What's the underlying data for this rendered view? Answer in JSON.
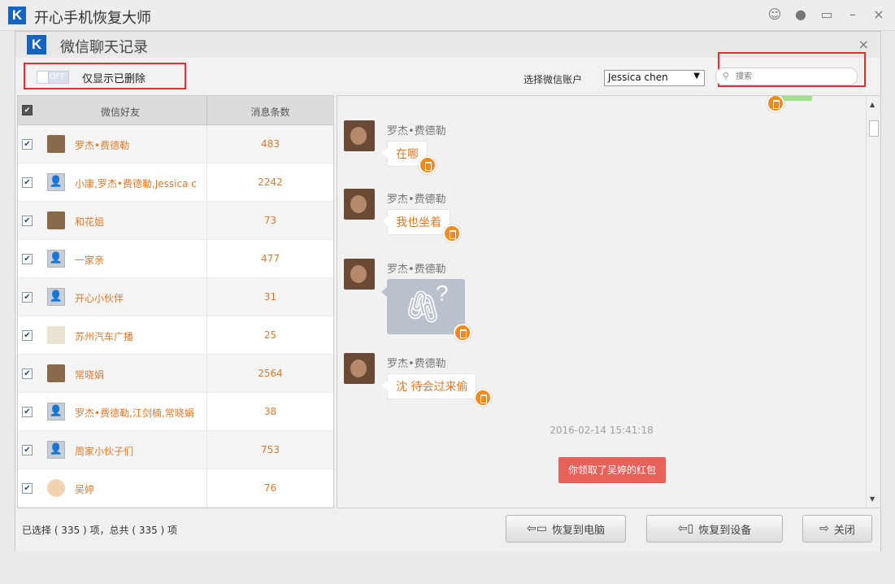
{
  "app": {
    "title": "开心手机恢复大师",
    "logo_letter": "K",
    "brand_color": "#1565c0"
  },
  "window_controls": [
    "wechat-icon",
    "chat-icon",
    "feedback-icon",
    "minimize",
    "close"
  ],
  "window_controls_glyphs": {
    "wechat": "☺",
    "chat": "●",
    "feedback": "▭",
    "minimize": "–",
    "close": "×"
  },
  "dialog": {
    "title": "微信聊天记录",
    "close_glyph": "×",
    "toolbar": {
      "toggle_state": "OFF",
      "filter_label": "仅显示已删除",
      "account_label": "选择微信账户",
      "account_selected": "Jessica chen",
      "search_placeholder": "搜索"
    },
    "list": {
      "columns": {
        "name": "微信好友",
        "count": "消息条数"
      },
      "rows": [
        {
          "name": "罗杰•费德勒",
          "count": "483",
          "avatar": "photo",
          "checked": true
        },
        {
          "name": "小康,罗杰•费德勒,Jessica c",
          "count": "2242",
          "avatar": "group",
          "checked": true
        },
        {
          "name": "和花姐",
          "count": "73",
          "avatar": "photo",
          "checked": true
        },
        {
          "name": "一家亲",
          "count": "477",
          "avatar": "group",
          "checked": true
        },
        {
          "name": "开心小伙伴",
          "count": "31",
          "avatar": "group",
          "checked": true
        },
        {
          "name": "苏州汽车广播",
          "count": "25",
          "avatar": "brand",
          "checked": true
        },
        {
          "name": "常晓娟",
          "count": "2564",
          "avatar": "photo",
          "checked": true
        },
        {
          "name": "罗杰•费德勒,江剑楠,常晓娟",
          "count": "38",
          "avatar": "group",
          "checked": true
        },
        {
          "name": "周家小伙子们",
          "count": "753",
          "avatar": "group",
          "checked": true
        },
        {
          "name": "吴婷",
          "count": "76",
          "avatar": "cartoon",
          "checked": true
        }
      ]
    },
    "chat": {
      "messages": [
        {
          "sender": "罗杰•费德勒",
          "text": "在哪",
          "kind": "text",
          "deleted": true
        },
        {
          "sender": "罗杰•费德勒",
          "text": "我也坐着",
          "kind": "text",
          "deleted": true
        },
        {
          "sender": "罗杰•费德勒",
          "text": "",
          "kind": "file",
          "deleted": true
        },
        {
          "sender": "罗杰•费德勒",
          "text": "沈 待会过来偷",
          "kind": "text",
          "deleted": true
        }
      ],
      "timestamp": "2016-02-14 15:41:18",
      "system_message": "你领取了吴婷的红包",
      "file_glyphs": {
        "clip": "🖇",
        "question": "?"
      }
    },
    "footer": {
      "status": "已选择 ( 335 ) 项，总共 ( 335 ) 项",
      "buttons": {
        "restore_pc": "恢复到电脑",
        "restore_device": "恢复到设备",
        "close": "关闭"
      }
    }
  },
  "colors": {
    "accent_orange": "#e07a2a",
    "highlight_red": "#e03030",
    "red_packet": "#e8605a"
  }
}
